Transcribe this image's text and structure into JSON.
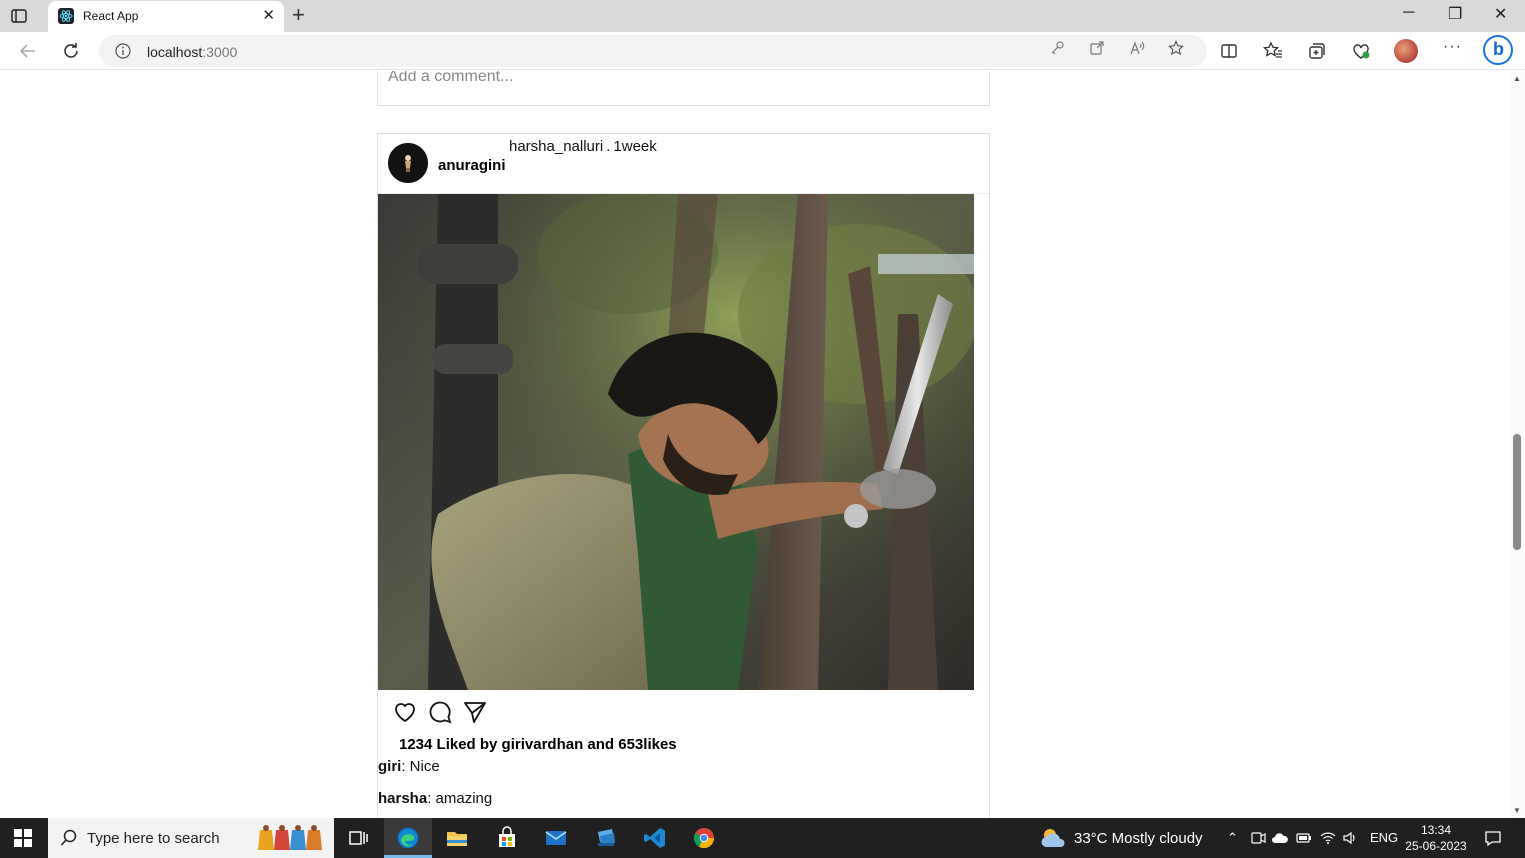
{
  "browser": {
    "tab_title": "React App",
    "tab_close": "✕",
    "new_tab": "+",
    "url_host": "localhost",
    "url_port": ":3000",
    "window": {
      "minimize": "─",
      "restore": "❐",
      "close": "✕"
    },
    "more": "···"
  },
  "page": {
    "comment_placeholder": "Add a comment...",
    "post": {
      "username": "anuragini",
      "author": "harsha_nalluri",
      "separator": ".",
      "time": "1week",
      "likes_text": "1234 Liked by girivardhan and 653likes",
      "comments": [
        {
          "user": "giri",
          "text": ": Nice"
        },
        {
          "user": "harsha",
          "text": ": amazing"
        }
      ]
    }
  },
  "taskbar": {
    "search_placeholder": "Type here to search",
    "weather": "33°C  Mostly cloudy",
    "language": "ENG",
    "time": "13:34",
    "date": "25-06-2023",
    "accent": "#76b9ed"
  }
}
